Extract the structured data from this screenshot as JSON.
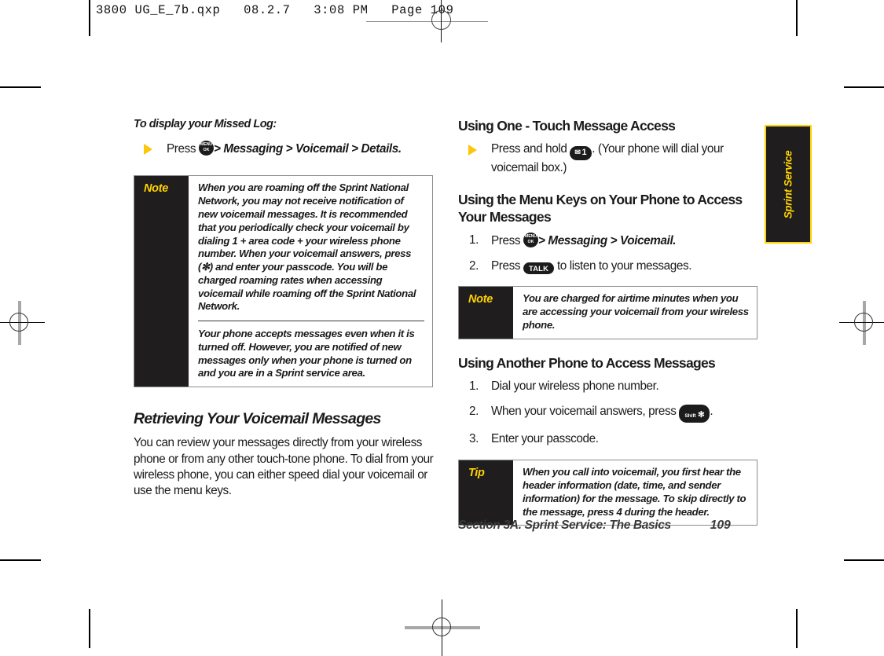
{
  "file_header": {
    "text": "3800 UG_E_7b.qxp   08.2.7   3:08 PM   Page 109"
  },
  "thumb_tab": {
    "label": "Sprint Service"
  },
  "left_column": {
    "intro_heading": "To display your Missed Log:",
    "bullet": {
      "press_label": "Press",
      "menu_key": {
        "line1": "MENU",
        "line2": "OK"
      },
      "path": "> Messaging > Voicemail > Details."
    },
    "note_box": {
      "label": "Note",
      "paragraph_1": "When you are roaming off the Sprint National Network, you may not receive notification of new voicemail messages. It is recommended that you periodically check your voicemail by dialing 1 + area code + your wireless phone number. When your voicemail answers, press (✻) and enter your passcode. You will be charged roaming rates when accessing voicemail while roaming off the Sprint National Network.",
      "paragraph_2": "Your phone accepts messages even when it is turned off. However, you are notified of new messages only when your phone is turned on and you are in a Sprint service area."
    },
    "section_heading": "Retrieving Your Voicemail Messages",
    "body_paragraph": "You can review your messages directly from your wireless phone or from any other touch-tone phone. To dial from your wireless phone, you can either speed dial your voicemail or use the menu keys."
  },
  "right_column": {
    "one_touch": {
      "heading": "Using One - Touch Message Access",
      "bullet_pre": "Press and hold",
      "voicemail_key": {
        "envelope": "✉",
        "digit": "1"
      },
      "bullet_post": ". (Your phone will dial your voicemail box.)"
    },
    "menu_keys": {
      "heading": "Using the Menu Keys on Your Phone to Access Your Messages",
      "steps": [
        {
          "num": "1.",
          "pre": "Press",
          "menu_key": {
            "line1": "MENU",
            "line2": "OK"
          },
          "post": "> Messaging > Voicemail."
        },
        {
          "num": "2.",
          "pre": "Press",
          "talk_key": "TALK",
          "post": "to listen to your messages."
        }
      ]
    },
    "note_box": {
      "label": "Note",
      "paragraph_1": "You are charged for airtime minutes when you are accessing your voicemail from your wireless phone."
    },
    "another_phone": {
      "heading": "Using Another Phone to Access Messages",
      "steps": [
        {
          "num": "1.",
          "pre": "Dial your wireless phone number.",
          "post": ""
        },
        {
          "num": "2.",
          "pre": "When your voicemail answers, press",
          "shift_key": {
            "label": "Shift",
            "star": "✻"
          },
          "post": "."
        },
        {
          "num": "3.",
          "pre": "Enter your passcode.",
          "post": ""
        }
      ]
    },
    "tip_box": {
      "label": "Tip",
      "text_before_key": "When you call into voicemail, you first hear the header information (date, time, and sender information) for the message. To skip directly to the message, press ",
      "key_digit": "4",
      "text_after_key": " during the header."
    }
  },
  "footer": {
    "section_title": "Section 3A. Sprint Service: The Basics",
    "page_number": "109"
  }
}
